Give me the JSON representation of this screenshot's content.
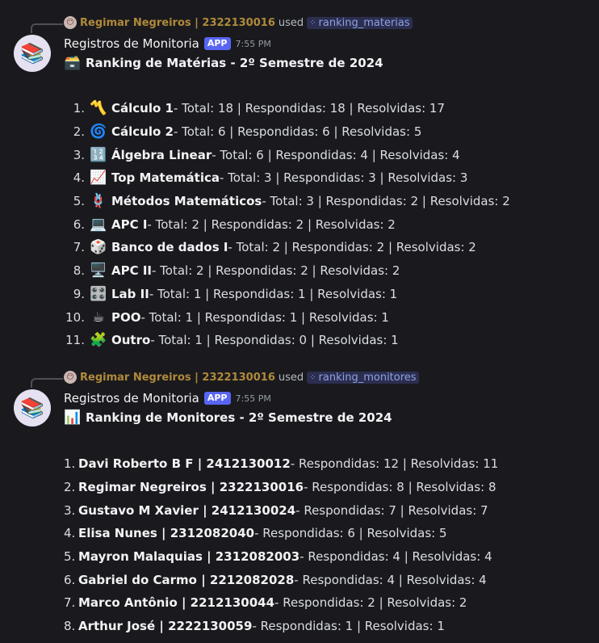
{
  "messages": [
    {
      "reply": {
        "user": "Regimar Negreiros | 2322130016",
        "used": "used",
        "command": "ranking_materias"
      },
      "author": "Registros de Monitoria",
      "tag": "APP",
      "time": "7:55 PM",
      "title_emoji": "🗃️",
      "title": "Ranking de Matérias - 2º Semestre de 2024",
      "items": [
        {
          "num": "1.",
          "emoji": "〽️",
          "name": "Cálculo 1",
          "stats": " - Total: 18 | Respondidas: 18 | Resolvidas: 17"
        },
        {
          "num": "2.",
          "emoji": "🌀",
          "name": "Cálculo 2",
          "stats": " - Total: 6 | Respondidas: 6 | Resolvidas: 5"
        },
        {
          "num": "3.",
          "emoji": "🔢",
          "name": "Álgebra Linear",
          "stats": " - Total: 6 | Respondidas: 4 | Resolvidas: 4"
        },
        {
          "num": "4.",
          "emoji": "📈",
          "name": "Top Matemática",
          "stats": " - Total: 3 | Respondidas: 3 | Resolvidas: 3"
        },
        {
          "num": "5.",
          "emoji": "🪢",
          "name": "Métodos Matemáticos",
          "stats": " - Total: 3 | Respondidas: 2 | Resolvidas: 2"
        },
        {
          "num": "6.",
          "emoji": "💻",
          "name": "APC I",
          "stats": " - Total: 2 | Respondidas: 2 | Resolvidas: 2"
        },
        {
          "num": "7.",
          "emoji": "🎲",
          "name": "Banco de dados I",
          "stats": " - Total: 2 | Respondidas: 2 | Resolvidas: 2"
        },
        {
          "num": "8.",
          "emoji": "🖥️",
          "name": "APC II",
          "stats": " - Total: 2 | Respondidas: 2 | Resolvidas: 2"
        },
        {
          "num": "9.",
          "emoji": "🎛️",
          "name": "Lab II",
          "stats": " - Total: 1 | Respondidas: 1 | Resolvidas: 1"
        },
        {
          "num": "10.",
          "emoji": "☕",
          "name": "POO",
          "stats": " - Total: 1 | Respondidas: 1 | Resolvidas: 1"
        },
        {
          "num": "11.",
          "emoji": "🧩",
          "name": "Outro",
          "stats": " - Total: 1 | Respondidas: 0 | Resolvidas: 1"
        }
      ]
    },
    {
      "reply": {
        "user": "Regimar Negreiros | 2322130016",
        "used": "used",
        "command": "ranking_monitores"
      },
      "author": "Registros de Monitoria",
      "tag": "APP",
      "time": "7:55 PM",
      "title_emoji": "📊",
      "title": "Ranking de Monitores - 2º Semestre de 2024",
      "items": [
        {
          "num": "1.",
          "name": "Davi Roberto B F | 2412130012",
          "stats": " - Respondidas: 12 | Resolvidas: 11"
        },
        {
          "num": "2.",
          "name": "Regimar Negreiros | 2322130016",
          "stats": " - Respondidas: 8 | Resolvidas: 8"
        },
        {
          "num": "3.",
          "name": "Gustavo M Xavier | 2412130024",
          "stats": " - Respondidas: 7 | Resolvidas: 7"
        },
        {
          "num": "4.",
          "name": "Elisa Nunes | 2312082040",
          "stats": " - Respondidas: 6 | Resolvidas: 5"
        },
        {
          "num": "5.",
          "name": "Mayron Malaquias | 2312082003",
          "stats": " - Respondidas: 4 | Resolvidas: 4"
        },
        {
          "num": "6.",
          "name": "Gabriel do Carmo | 2212082028",
          "stats": " - Respondidas: 4 | Resolvidas: 4"
        },
        {
          "num": "7.",
          "name": "Marco Antônio | 2212130044",
          "stats": " - Respondidas: 2 | Resolvidas: 2"
        },
        {
          "num": "8.",
          "name": "Arthur José | 2222130059",
          "stats": " - Respondidas: 1 | Resolvidas: 1"
        }
      ]
    }
  ],
  "icons": {
    "bot_avatar": "📚",
    "mini_avatar": "😶",
    "command": "⁘"
  },
  "colors": {
    "background": "#1a1a1e",
    "app_tag": "#5865f2",
    "reply_name": "#b08a3a",
    "command_text": "#8ea1e1"
  }
}
